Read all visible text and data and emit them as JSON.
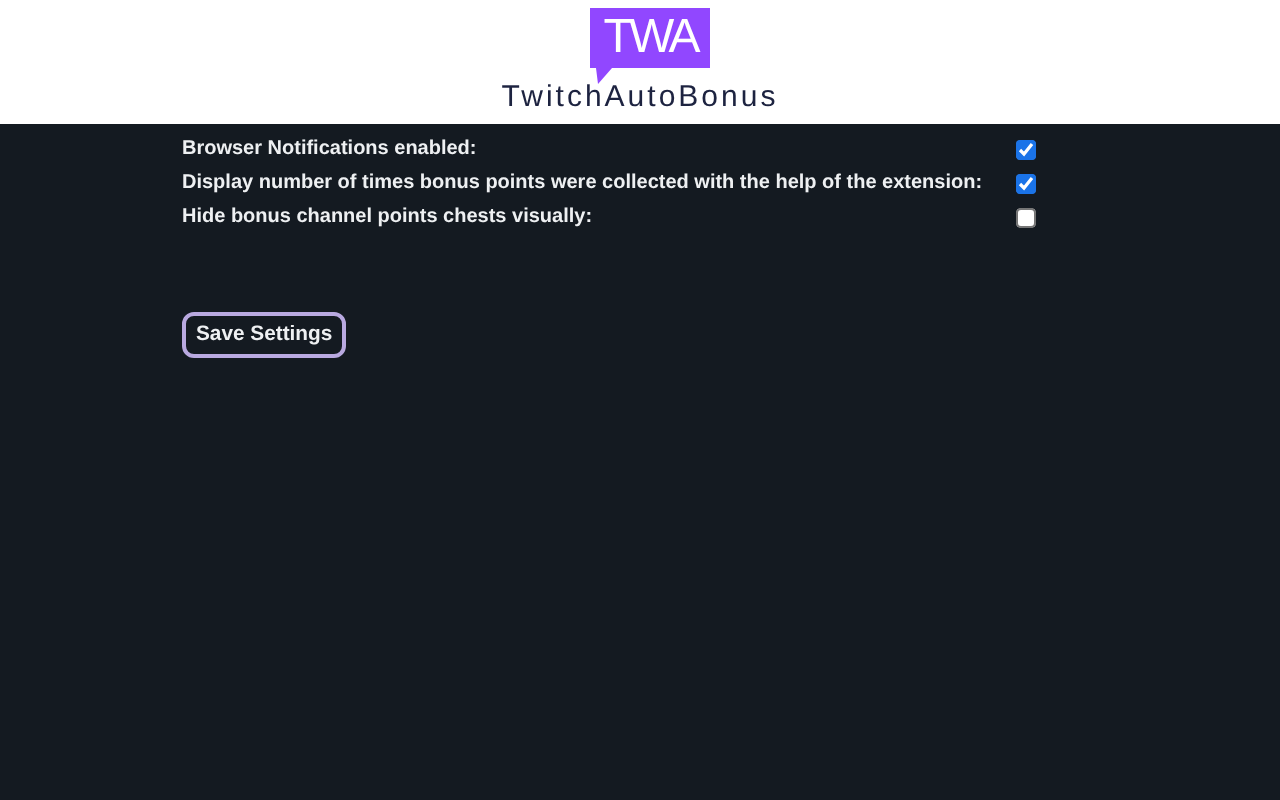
{
  "header": {
    "logo_mark": "TWA",
    "logo_text": "TwitchAutoBonus"
  },
  "settings": [
    {
      "label": "Browser Notifications enabled:",
      "checked": true
    },
    {
      "label": "Display number of times bonus points were collected with the help of the extension:",
      "checked": true
    },
    {
      "label": "Hide bonus channel points chests visually:",
      "checked": false
    }
  ],
  "buttons": [
    "Save Settings"
  ]
}
